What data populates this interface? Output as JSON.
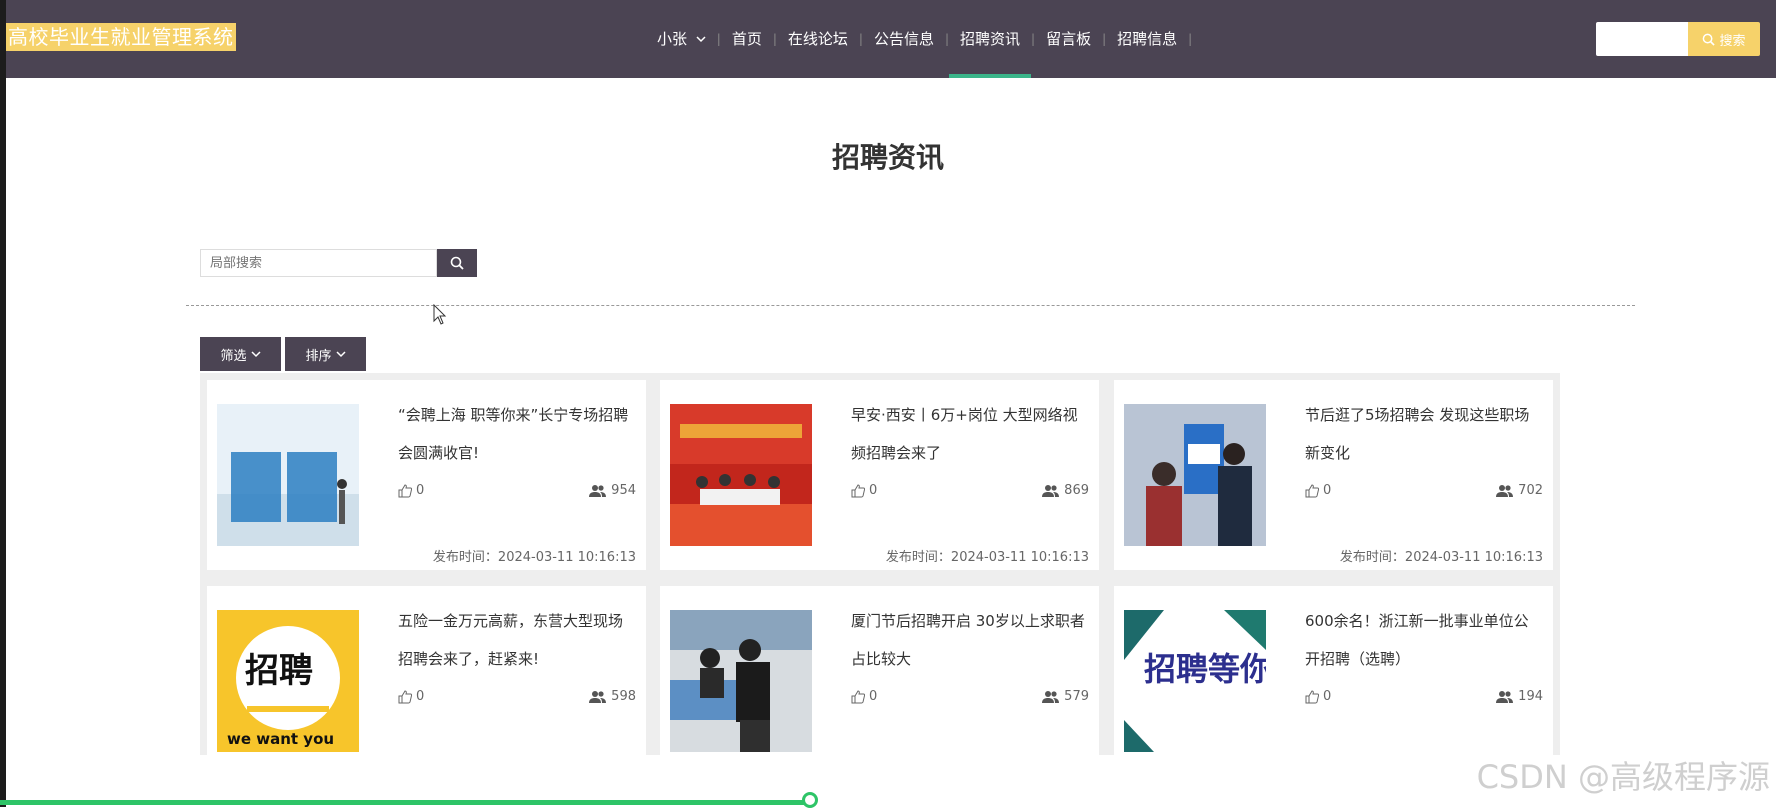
{
  "app": {
    "brand": "高校毕业生就业管理系统"
  },
  "nav": {
    "user_label": "小张",
    "items": [
      "首页",
      "在线论坛",
      "公告信息",
      "招聘资讯",
      "留言板",
      "招聘信息"
    ],
    "active": "招聘资讯"
  },
  "top_search": {
    "value": "",
    "button_label": "搜索"
  },
  "page": {
    "title": "招聘资讯"
  },
  "local_search": {
    "placeholder": "局部搜索"
  },
  "filters": {
    "filter_label": "筛选",
    "sort_label": "排序"
  },
  "cards": [
    {
      "title": "“会聘上海 职等你来”长宁专场招聘会圆满收官!",
      "likes": "0",
      "views": "954",
      "time": "发布时间：2024-03-11 10:16:13",
      "image": "blue-zhaopin-3d"
    },
    {
      "title": "早安·西安丨6万+岗位 大型网络视频招聘会来了",
      "likes": "0",
      "views": "869",
      "time": "发布时间：2024-03-11 10:16:13",
      "image": "livestream-stage"
    },
    {
      "title": "节后逛了5场招聘会 发现这些职场新变化",
      "likes": "0",
      "views": "702",
      "time": "发布时间：2024-03-11 10:16:13",
      "image": "job-fair-crowd"
    },
    {
      "title": "五险一金万元高薪，东营大型现场招聘会来了，赶紧来!",
      "likes": "0",
      "views": "598",
      "time": "",
      "image": "yellow-we-want-you",
      "image_text": "招聘",
      "image_caption": "we want you"
    },
    {
      "title": "厦门节后招聘开启 30岁以上求职者占比较大",
      "likes": "0",
      "views": "579",
      "time": "",
      "image": "office-interview"
    },
    {
      "title": "600余名！浙江新一批事业单位公开招聘（选聘）",
      "likes": "0",
      "views": "194",
      "time": "",
      "image": "zhaopin-dengnilai",
      "image_text": "招聘等你来!"
    }
  ],
  "watermark": "CSDN @高级程序源",
  "video_progress": 0.456,
  "colors": {
    "nav_bg": "#4b4453",
    "brand_bg": "#f6d26a",
    "accent": "#3bb58a",
    "progress": "#2ec467"
  }
}
